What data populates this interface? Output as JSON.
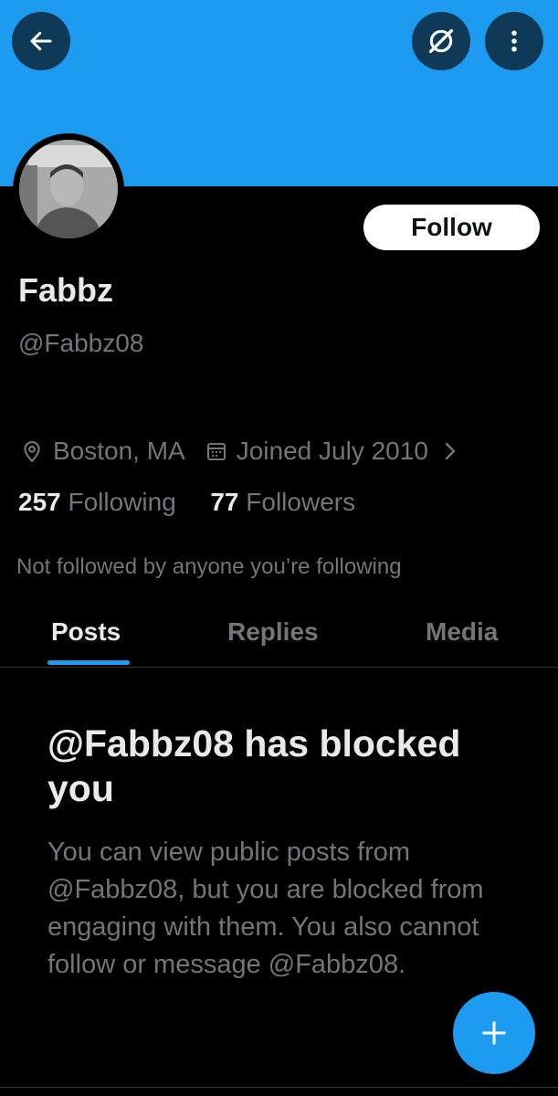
{
  "header": {
    "back_icon": "arrow-left-icon",
    "translate_icon": "grok-slash-icon",
    "more_icon": "vertical-ellipsis-icon",
    "banner_color": "#1d9bf0"
  },
  "profile": {
    "avatar_icon": "avatar-photo",
    "follow_label": "Follow",
    "name": "Fabbz",
    "handle": "@Fabbz08",
    "location": "Boston, MA",
    "joined": "Joined July 2010",
    "following_count": "257",
    "following_label": "Following",
    "followers_count": "77",
    "followers_label": "Followers",
    "not_followed_text": "Not followed by anyone you’re following"
  },
  "tabs": [
    {
      "label": "Posts",
      "active": true
    },
    {
      "label": "Replies",
      "active": false
    },
    {
      "label": "Media",
      "active": false
    }
  ],
  "blocked": {
    "title": "@Fabbz08 has blocked you",
    "body": "You can view public posts from @Fabbz08, but you are blocked from engaging with them. You also cannot follow or message @Fabbz08."
  },
  "fab": {
    "icon": "plus-icon"
  },
  "colors": {
    "accent": "#1d9bf0",
    "background": "#000000",
    "secondary_text": "#71767b",
    "primary_text": "#e7e9ea"
  }
}
